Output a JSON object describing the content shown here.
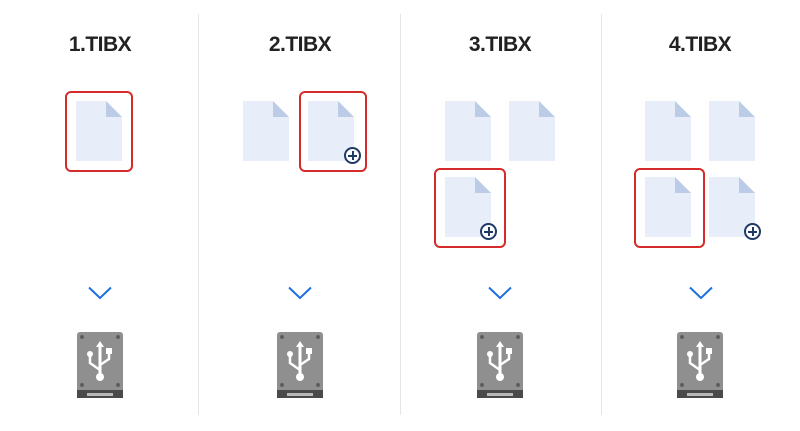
{
  "columns": [
    {
      "title": "1.TIBX",
      "files": 1,
      "selected_file": 1,
      "plus_on": null
    },
    {
      "title": "2.TIBX",
      "files": 2,
      "selected_file": 2,
      "plus_on": 2
    },
    {
      "title": "3.TIBX",
      "files": 3,
      "selected_file": 3,
      "plus_on": 3
    },
    {
      "title": "4.TIBX",
      "files": 4,
      "selected_file": 3,
      "plus_on": 4
    }
  ],
  "icons": {
    "file": "document-icon",
    "add": "plus-circle-icon",
    "arrow": "chevron-down-icon",
    "destination": "usb-drive-icon"
  },
  "colors": {
    "file_fill": "#e8eef9",
    "file_fold": "#bccbe6",
    "highlight": "#d62b2b",
    "chevron": "#1e6fe0",
    "drive_body": "#8f8f8f",
    "plus_icon": "#1f3a66"
  }
}
